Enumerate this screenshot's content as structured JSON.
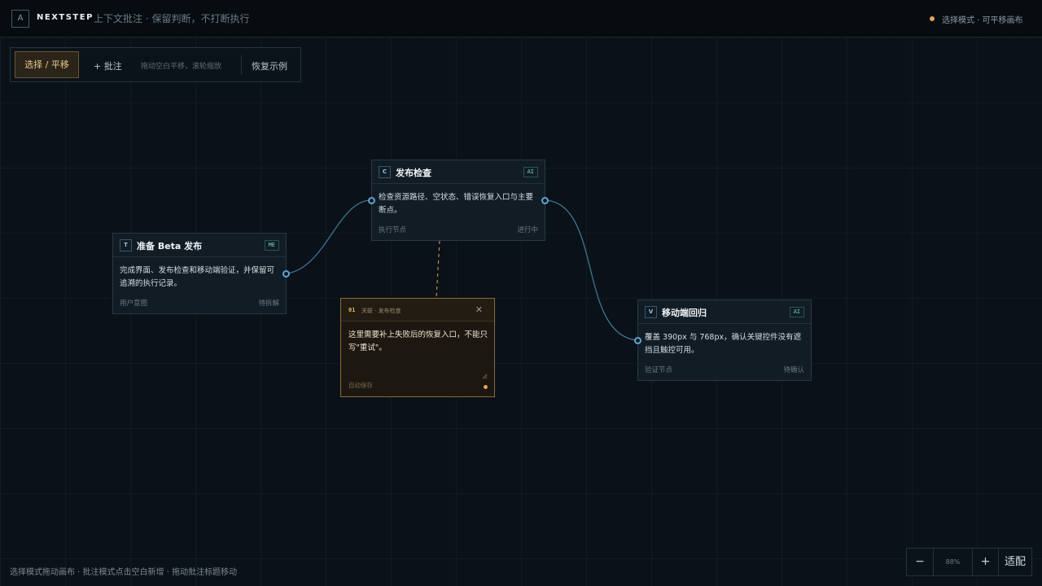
{
  "header": {
    "logo_letter": "A",
    "brand": "NEXTSTEP",
    "tagline": "上下文批注 · 保留判断，不打断执行",
    "status": "选择模式 · 可平移画布",
    "status_color": "#e0a35c"
  },
  "toolbar": {
    "select_label": "选择 / 平移",
    "annotate_label": "+ 批注",
    "hint": "拖动空白平移，滚轮缩放",
    "reset_label": "恢复示例"
  },
  "nodes": [
    {
      "letter": "T",
      "title": "准备 Beta 发布",
      "badge": "ME",
      "desc": "完成界面、发布检查和移动端验证，并保留可追溯的执行记录。",
      "type": "用户意图",
      "state": "待拆解"
    },
    {
      "letter": "C",
      "title": "发布检查",
      "badge": "AI",
      "desc": "检查资源路径、空状态、错误恢复入口与主要断点。",
      "type": "执行节点",
      "state": "进行中"
    },
    {
      "letter": "V",
      "title": "移动端回归",
      "badge": "AI",
      "desc": "覆盖 390px 与 768px，确认关键控件没有遮挡且触控可用。",
      "type": "验证节点",
      "state": "待确认"
    }
  ],
  "annotation": {
    "number": "01",
    "meta": "关联 · 发布检查",
    "body": "这里需要补上失败后的恢复入口，不能只写\"重试\"。",
    "autosave": "自动保存",
    "accent": "#e0a35c"
  },
  "footer": {
    "hint": "选择模式拖动画布 · 批注模式点击空白新增 · 拖动批注标题移动"
  },
  "zoom": {
    "out_label": "−",
    "value": "88%",
    "in_label": "+",
    "fit_label": "适配"
  }
}
